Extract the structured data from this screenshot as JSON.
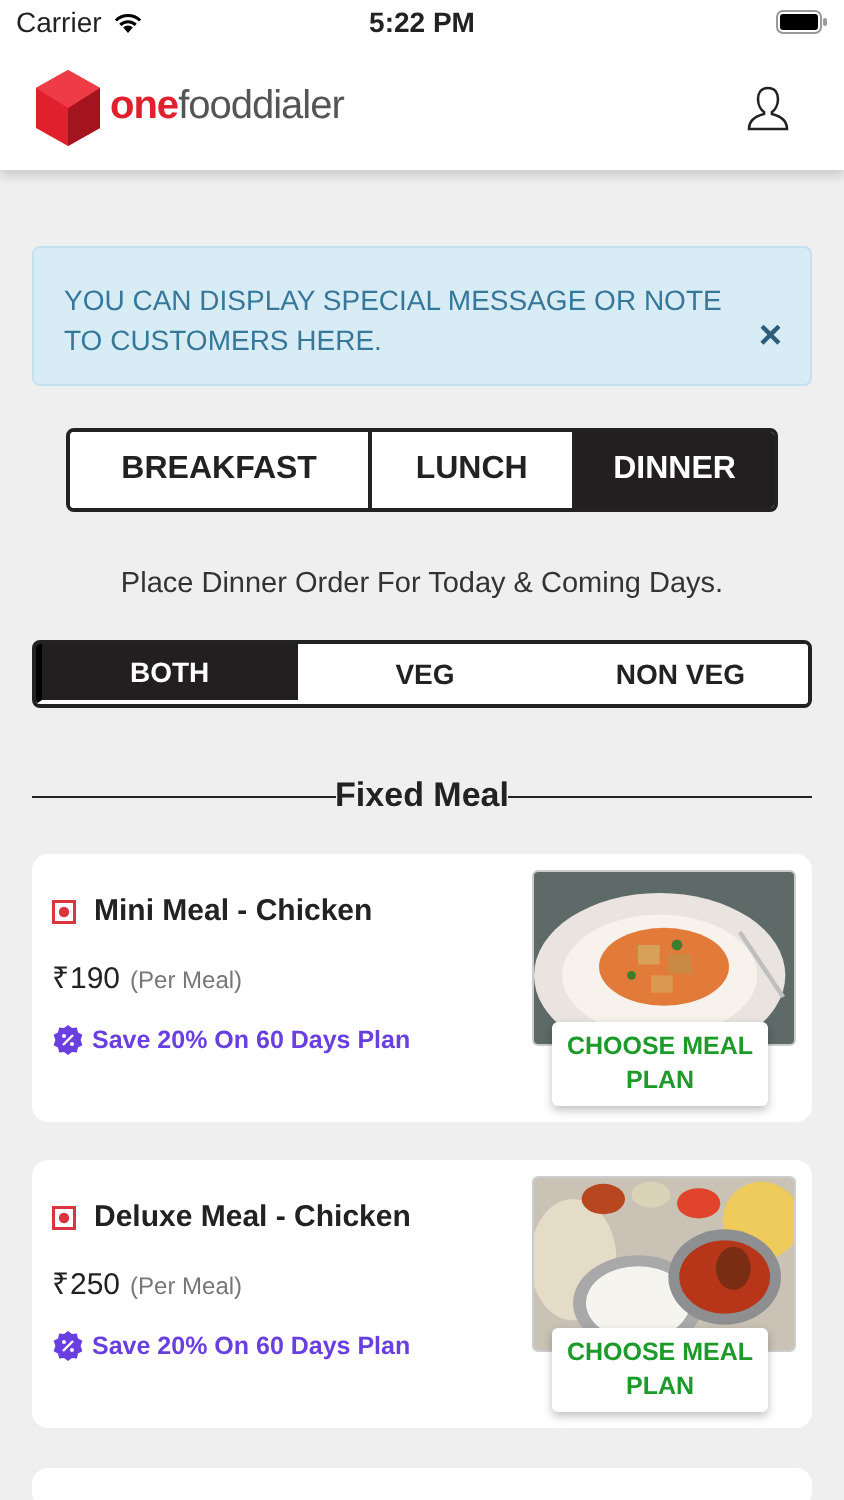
{
  "status_bar": {
    "carrier": "Carrier",
    "time": "5:22 PM"
  },
  "header": {
    "logo_parts": [
      "one",
      "fooddialer"
    ]
  },
  "notice": {
    "text": "YOU CAN DISPLAY SPECIAL MESSAGE OR NOTE TO CUSTOMERS HERE.",
    "close": "×"
  },
  "meal_tabs": [
    {
      "label": "BREAKFAST",
      "selected": false
    },
    {
      "label": "LUNCH",
      "selected": false
    },
    {
      "label": "DINNER",
      "selected": true
    }
  ],
  "subtitle": "Place Dinner Order For Today & Coming Days.",
  "diet_filter": [
    {
      "label": "BOTH",
      "selected": true
    },
    {
      "label": "VEG",
      "selected": false
    },
    {
      "label": "NON VEG",
      "selected": false
    }
  ],
  "section_title": "Fixed Meal",
  "meals": [
    {
      "name": "Mini Meal - Chicken",
      "non_veg": true,
      "price": "₹190",
      "unit": "(Per Meal)",
      "offer": "Save 20% On 60 Days Plan",
      "button": "CHOOSE MEAL PLAN"
    },
    {
      "name": "Deluxe Meal - Chicken",
      "non_veg": true,
      "price": "₹250",
      "unit": "(Per Meal)",
      "offer": "Save 20% On 60 Days Plan",
      "button": "CHOOSE MEAL PLAN"
    }
  ]
}
